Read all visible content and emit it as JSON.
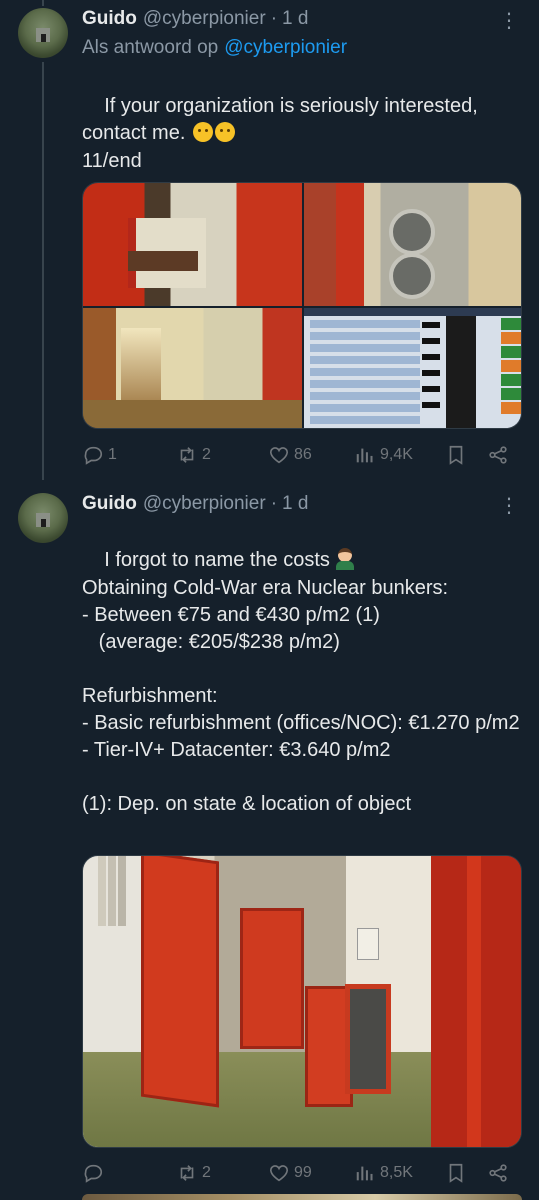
{
  "tweets": [
    {
      "name": "Guido",
      "handle": "@cyberpionier",
      "sep": "·",
      "time": "1 d",
      "more": "⋮",
      "reply_prefix": "Als antwoord op",
      "reply_mention": "@cyberpionier",
      "text": "If your organization is seriously interested, contact me. ",
      "text_emoji": [
        "winking-face",
        "saluting-face"
      ],
      "text2": "11/end",
      "actions": {
        "replies": "1",
        "retweets": "2",
        "likes": "86",
        "views": "9,4K"
      }
    },
    {
      "name": "Guido",
      "handle": "@cyberpionier",
      "sep": "·",
      "time": "1 d",
      "more": "⋮",
      "text_first": "I forgot to name the costs",
      "text_emoji": [
        "man-facepalming"
      ],
      "text_body": "Obtaining Cold-War era Nuclear bunkers:\n- Between €75 and €430 p/m2 (1)\n   (average: €205/$238 p/m2)\n\nRefurbishment:\n- Basic refurbishment (offices/NOC): €1.270 p/m2\n- Tier-IV+ Datacenter: €3.640 p/m2\n\n(1): Dep. on state & location of object",
      "actions": {
        "replies": "",
        "retweets": "2",
        "likes": "99",
        "views": "8,5K"
      }
    }
  ],
  "colors": {
    "background": "#15202b",
    "text": "#e7e9ea",
    "muted": "#8b98a5",
    "link": "#1d9bf0",
    "icon": "#71767b"
  },
  "icons": [
    "reply-icon",
    "retweet-icon",
    "like-icon",
    "views-icon",
    "bookmark-icon",
    "share-icon",
    "more-icon"
  ]
}
